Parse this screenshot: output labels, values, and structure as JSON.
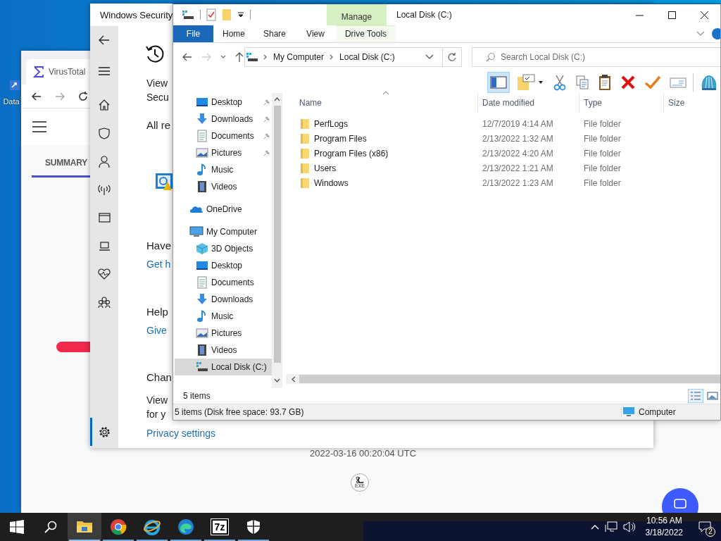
{
  "desktop": {
    "shortcut": {
      "label": "Data"
    }
  },
  "browser": {
    "tab_title": "VirusTotal",
    "summary_tab": "SUMMARY",
    "timestamp": "2022-03-16 00:20:04 UTC",
    "file_badge": "EXE"
  },
  "security": {
    "title": "Windows Security",
    "nav": [
      {
        "kind": "back",
        "selected": false
      },
      {
        "kind": "menu",
        "selected": false
      },
      {
        "kind": "home",
        "selected": false
      },
      {
        "kind": "shield",
        "selected": false
      },
      {
        "kind": "account",
        "selected": false
      },
      {
        "kind": "network",
        "selected": false
      },
      {
        "kind": "app",
        "selected": false
      },
      {
        "kind": "device",
        "selected": false
      },
      {
        "kind": "health",
        "selected": false
      },
      {
        "kind": "family",
        "selected": false
      },
      {
        "kind": "settings",
        "selected": true
      }
    ],
    "intro": [
      "View",
      "Secu"
    ],
    "recent": "All re",
    "help_heading": "Have",
    "help_link": "Get h",
    "feedback_heading": "Help",
    "feedback_link": "Give",
    "privacy_heading": "Chan",
    "privacy_text": [
      "View",
      "for y"
    ],
    "privacy_link": "Privacy settings"
  },
  "explorer": {
    "title": "Local Disk (C:)",
    "context_tab": "Manage",
    "ribbon_tabs": [
      {
        "label": "File",
        "kind": "file"
      },
      {
        "label": "Home",
        "kind": "plain"
      },
      {
        "label": "Share",
        "kind": "plain"
      },
      {
        "label": "View",
        "kind": "plain"
      },
      {
        "label": "Drive Tools",
        "kind": "context"
      }
    ],
    "address": [
      "My Computer",
      "Local Disk (C:)"
    ],
    "search": {
      "placeholder": "Search Local Disk (C:)"
    },
    "toolbar": [
      {
        "kind": "pane",
        "selected": true
      },
      {
        "kind": "view",
        "selected": false
      },
      {
        "kind": "cut",
        "selected": false
      },
      {
        "kind": "copy",
        "selected": false
      },
      {
        "kind": "paste",
        "selected": false
      },
      {
        "kind": "delete",
        "selected": false
      },
      {
        "kind": "check",
        "selected": false
      },
      {
        "kind": "rename",
        "selected": false
      },
      {
        "kind": "shell",
        "selected": false
      }
    ],
    "quick_access": [
      {
        "label": "Desktop",
        "kind": "desktop",
        "pinned": true,
        "selected": false
      },
      {
        "label": "Downloads",
        "kind": "downloads",
        "pinned": true,
        "selected": false
      },
      {
        "label": "Documents",
        "kind": "documents",
        "pinned": true,
        "selected": false
      },
      {
        "label": "Pictures",
        "kind": "pictures",
        "pinned": true,
        "selected": false
      },
      {
        "label": "Music",
        "kind": "music",
        "pinned": false,
        "selected": false
      },
      {
        "label": "Videos",
        "kind": "videos",
        "pinned": false,
        "selected": false
      }
    ],
    "locations": [
      {
        "label": "OneDrive",
        "kind": "cloud",
        "selected": false
      },
      {
        "label": "My Computer",
        "kind": "computer",
        "selected": false,
        "children": [
          {
            "label": "3D Objects",
            "kind": "objects",
            "selected": false
          },
          {
            "label": "Desktop",
            "kind": "desktop",
            "selected": false
          },
          {
            "label": "Documents",
            "kind": "documents",
            "selected": false
          },
          {
            "label": "Downloads",
            "kind": "downloads",
            "selected": false
          },
          {
            "label": "Music",
            "kind": "music",
            "selected": false
          },
          {
            "label": "Pictures",
            "kind": "pictures",
            "selected": false
          },
          {
            "label": "Videos",
            "kind": "videos",
            "selected": false
          },
          {
            "label": "Local Disk (C:)",
            "kind": "drive",
            "selected": true
          }
        ]
      }
    ],
    "columns": [
      "Name",
      "Date modified",
      "Type",
      "Size"
    ],
    "rows": [
      {
        "name": "PerfLogs",
        "date": "12/7/2019 4:14 AM",
        "type": "File folder"
      },
      {
        "name": "Program Files",
        "date": "2/13/2022 1:32 AM",
        "type": "File folder"
      },
      {
        "name": "Program Files (x86)",
        "date": "2/13/2022 4:20 AM",
        "type": "File folder"
      },
      {
        "name": "Users",
        "date": "2/13/2022 1:21 AM",
        "type": "File folder"
      },
      {
        "name": "Windows",
        "date": "2/13/2022 1:23 AM",
        "type": "File folder"
      }
    ],
    "item_count": "5 items",
    "status": "5 items (Disk free space: 93.7 GB)",
    "status_location": "Computer"
  },
  "taskbar": {
    "apps": [
      {
        "kind": "explorer",
        "selected": true
      },
      {
        "kind": "chrome",
        "selected": false
      },
      {
        "kind": "ie",
        "selected": false
      },
      {
        "kind": "edge",
        "selected": false
      },
      {
        "kind": "sevenzip",
        "label": "7z",
        "selected": false
      },
      {
        "kind": "defender",
        "selected": false
      }
    ],
    "time": "10:56 AM",
    "date": "3/18/2022",
    "notifications": "2"
  }
}
